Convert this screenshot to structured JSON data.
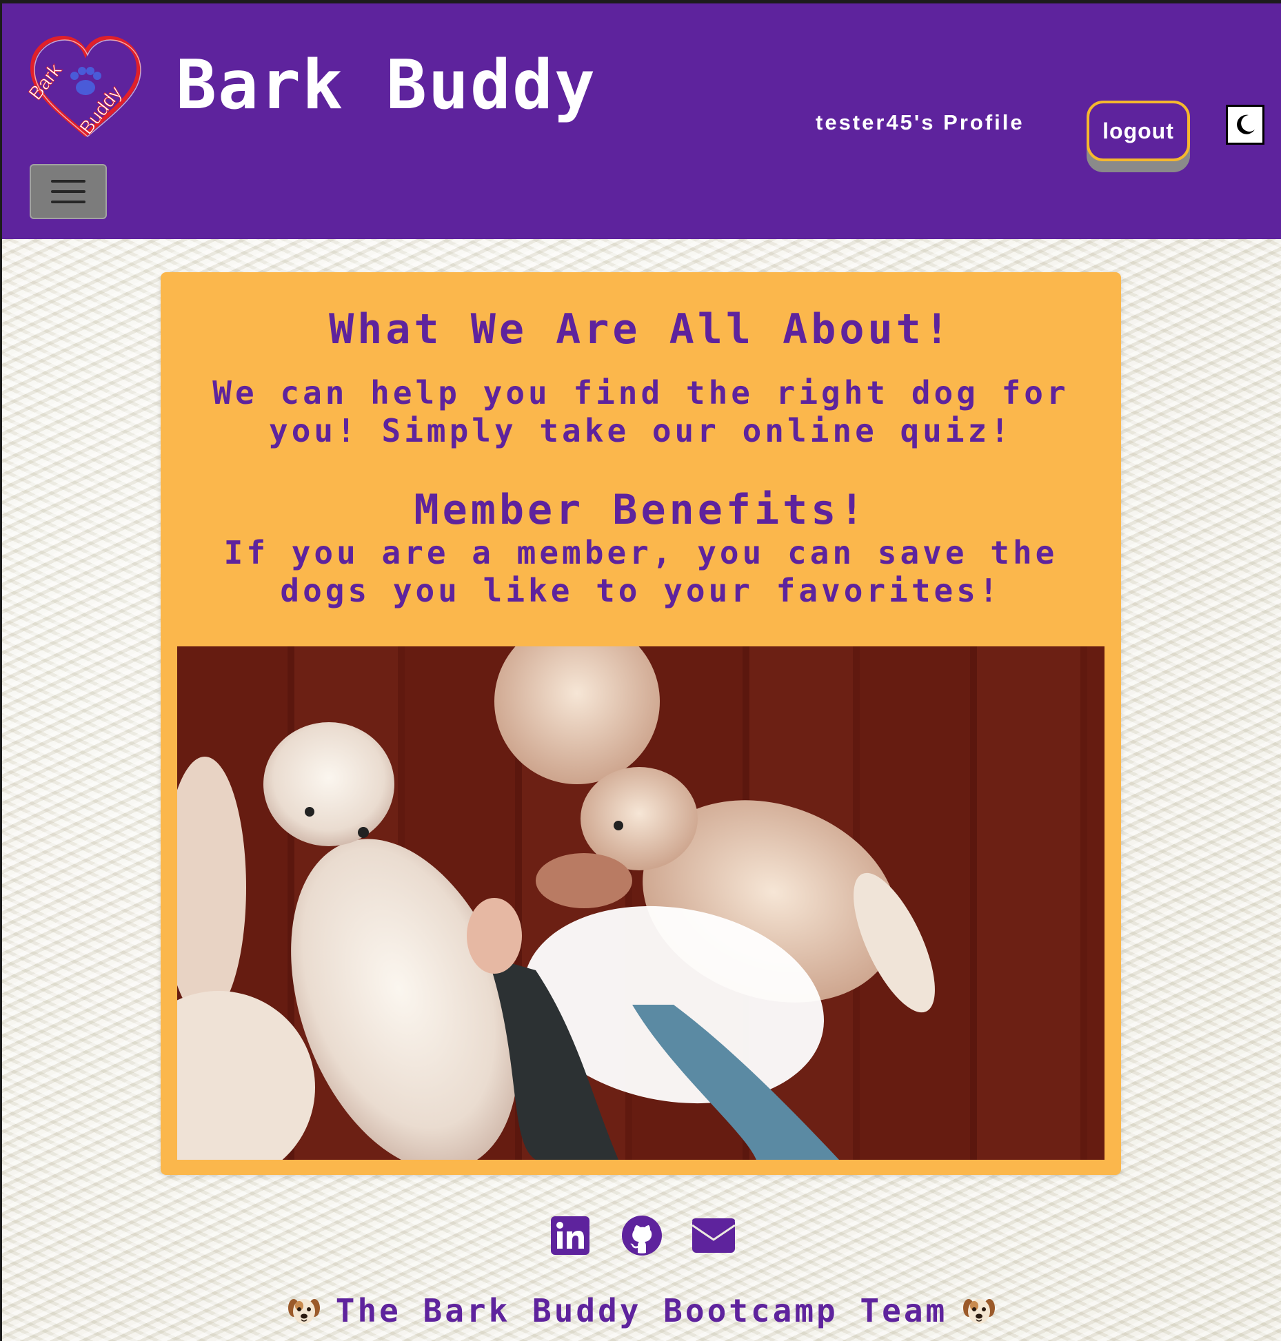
{
  "header": {
    "logo_text_top": "Bark",
    "logo_text_bottom": "Buddy",
    "title": "Bark Buddy",
    "profile_link": "tester45's Profile",
    "logout_label": "logout",
    "theme_toggle_icon": "moon-icon",
    "menu_icon": "hamburger-menu-icon"
  },
  "main": {
    "about_heading": "What We Are All About!",
    "about_text": "We can help you find the right dog for you! Simply take our online quiz!",
    "benefits_heading": "Member Benefits!",
    "benefits_text": "If you are a member, you can save the dogs you like to your favorites!",
    "image_icon": "puppies-image"
  },
  "footer": {
    "social_icons": [
      "linkedin-icon",
      "github-icon",
      "email-icon"
    ],
    "team_text": "The Bark Buddy Bootcamp Team",
    "emoji_icon": "dog-face-icon"
  },
  "colors": {
    "primary_purple": "#5e239d",
    "card_orange": "#fbb74c",
    "logout_border": "#f5b82e"
  }
}
